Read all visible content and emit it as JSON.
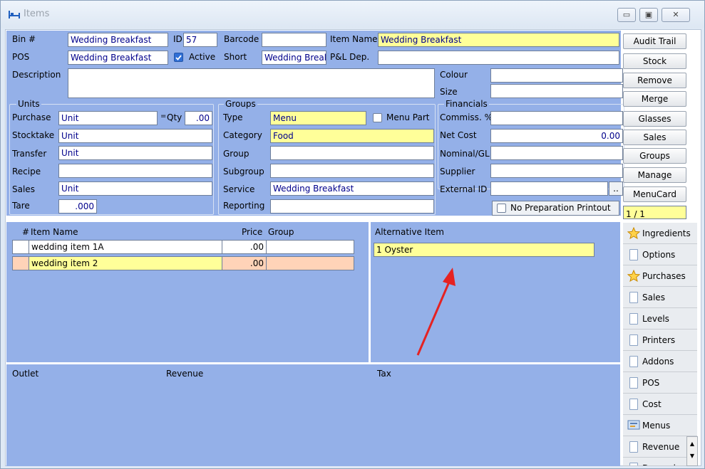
{
  "window": {
    "title": "Items"
  },
  "header": {
    "bin_label": "Bin #",
    "bin_value": "Wedding Breakfast",
    "id_label": "ID",
    "id_value": "57",
    "barcode_label": "Barcode",
    "barcode_value": "",
    "item_name_label": "Item Name",
    "item_name_value": "Wedding Breakfast",
    "pos_label": "POS",
    "pos_value": "Wedding Breakfast",
    "active_label": "Active",
    "active_checked": true,
    "short_label": "Short",
    "short_value": "Wedding Break",
    "pl_dep_label": "P&L Dep.",
    "pl_dep_value": "",
    "description_label": "Description",
    "description_value": "",
    "colour_label": "Colour",
    "colour_value": "",
    "size_label": "Size",
    "size_value": ""
  },
  "units": {
    "title": "Units",
    "purchase_label": "Purchase",
    "purchase_value": "Unit",
    "eq_label": "=",
    "qty_label": "Qty",
    "qty_value": ".00",
    "stocktake_label": "Stocktake",
    "stocktake_value": "Unit",
    "transfer_label": "Transfer",
    "transfer_value": "Unit",
    "recipe_label": "Recipe",
    "recipe_value": "",
    "sales_label": "Sales",
    "sales_value": "Unit",
    "tare_label": "Tare",
    "tare_value": ".000"
  },
  "groups": {
    "title": "Groups",
    "type_label": "Type",
    "type_value": "Menu",
    "menu_part_label": "Menu Part",
    "category_label": "Category",
    "category_value": "Food",
    "group_label": "Group",
    "group_value": "",
    "subgroup_label": "Subgroup",
    "subgroup_value": "",
    "service_label": "Service",
    "service_value": "Wedding Breakfast",
    "reporting_label": "Reporting",
    "reporting_value": ""
  },
  "financials": {
    "title": "Financials",
    "commiss_label": "Commiss. %",
    "commiss_value": "",
    "net_cost_label": "Net Cost",
    "net_cost_value": "0.00",
    "nominal_label": "Nominal/GL",
    "nominal_value": "",
    "supplier_label": "Supplier",
    "supplier_value": "",
    "external_label": "External ID",
    "external_value": "",
    "ellipsis": "..",
    "no_prep_label": "No Preparation Printout"
  },
  "right_buttons": [
    "Audit Trail",
    "Stock",
    "Remove",
    "Merge",
    "Glasses",
    "Sales",
    "Groups",
    "Manage",
    "MenuCard"
  ],
  "pager": "1 / 1",
  "items_grid": {
    "headers": {
      "num": "#",
      "name": "Item Name",
      "price": "Price",
      "group": "Group"
    },
    "rows": [
      {
        "name": "wedding item 1A",
        "price": ".00",
        "group": ""
      },
      {
        "name": "wedding item 2",
        "price": ".00",
        "group": ""
      }
    ]
  },
  "alternative": {
    "header": "Alternative Item",
    "value": "1 Oyster"
  },
  "outlet_grid": {
    "outlet": "Outlet",
    "revenue": "Revenue",
    "tax": "Tax"
  },
  "tabs": [
    {
      "label": "Ingredients",
      "icon": "star-icon"
    },
    {
      "label": "Options",
      "icon": "page-icon"
    },
    {
      "label": "Purchases",
      "icon": "star-icon"
    },
    {
      "label": "Sales",
      "icon": "page-icon"
    },
    {
      "label": "Levels",
      "icon": "page-icon"
    },
    {
      "label": "Printers",
      "icon": "page-icon"
    },
    {
      "label": "Addons",
      "icon": "page-icon"
    },
    {
      "label": "POS",
      "icon": "page-icon"
    },
    {
      "label": "Cost",
      "icon": "page-icon"
    },
    {
      "label": "Menus",
      "icon": "menus-icon"
    },
    {
      "label": "Revenue",
      "icon": "page-icon"
    },
    {
      "label": "Dependen",
      "icon": "page-icon"
    }
  ],
  "colors": {
    "panel": "#94b0e8",
    "highlight": "#ffff99",
    "row_pink": "#ffd3b8",
    "arrow": "#e52222"
  }
}
